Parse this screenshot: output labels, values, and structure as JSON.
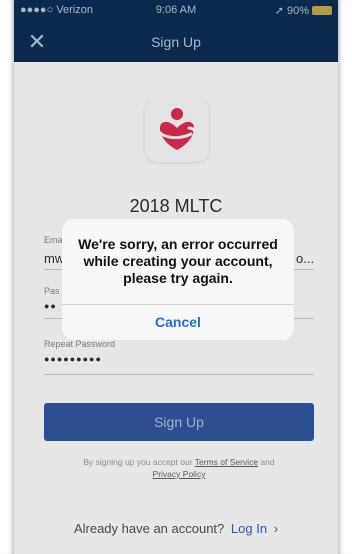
{
  "status_bar": {
    "carrier": "●●●●○ Verizon",
    "time": "9:06 AM",
    "battery": "90%",
    "location_arrow": "➚"
  },
  "nav": {
    "title": "Sign Up",
    "close_glyph": "✕"
  },
  "app": {
    "name": "2018 MLTC",
    "logo_color": "#c8284a"
  },
  "form": {
    "email_label": "Ema",
    "email_value": "mw",
    "email_trunc": "o...",
    "password_label": "Pas",
    "password_value": "●●",
    "repeat_label": "Repeat Password",
    "repeat_value": "●●●●●●●●●"
  },
  "signup_button": "Sign Up",
  "terms": {
    "prefix": "By signing up you accept our",
    "tos": "Terms of Service",
    "and": "and",
    "privacy": "Privacy Policy"
  },
  "login": {
    "prompt": "Already have an account?",
    "link": "Log In",
    "chevron": "›"
  },
  "alert": {
    "message": "We're sorry, an error occurred while creating your account, please try again.",
    "cancel": "Cancel"
  },
  "colors": {
    "nav_bg": "#0d2a4e",
    "button_bg": "#2d4f92",
    "alert_action": "#1d6fd6"
  }
}
